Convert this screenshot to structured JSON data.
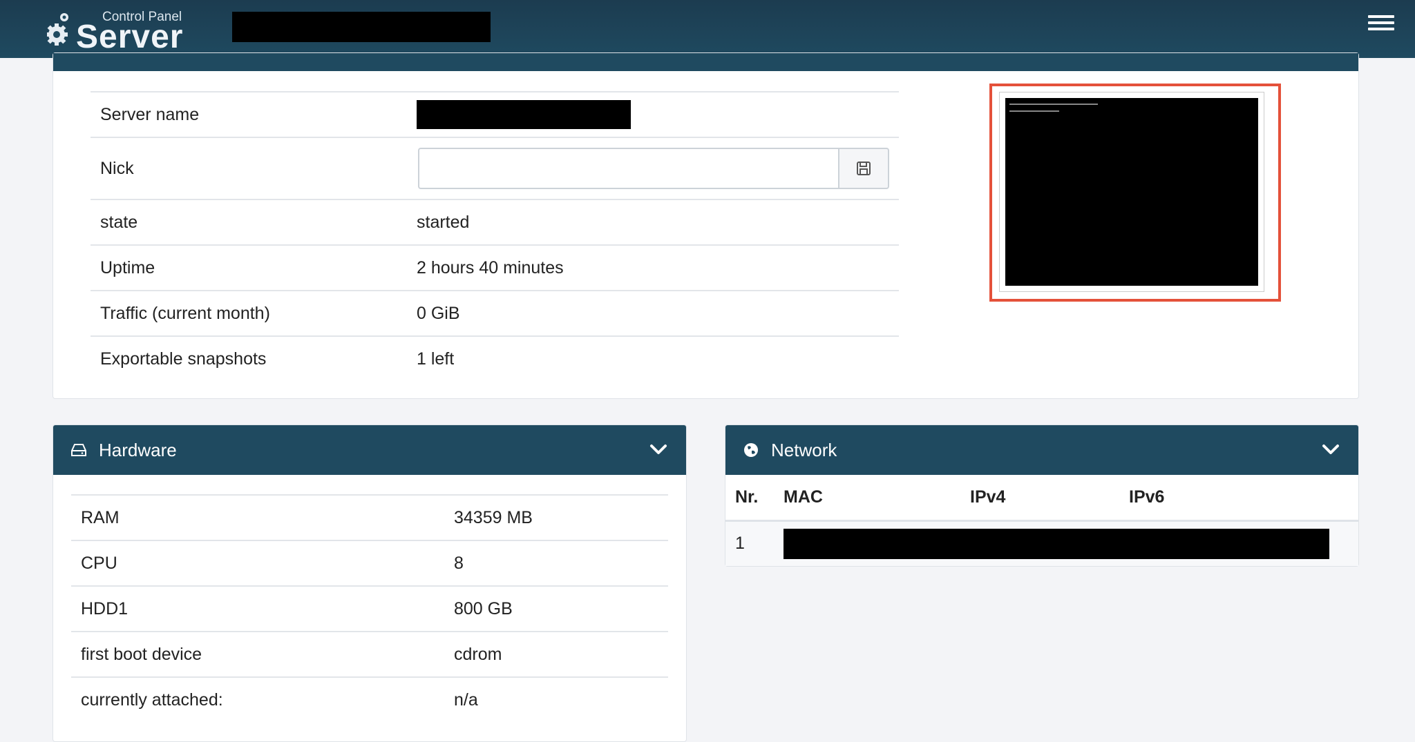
{
  "header": {
    "logo_small": "Control Panel",
    "logo_big": "Server",
    "menu_icon": "hamburger-icon"
  },
  "server_info": {
    "rows": [
      {
        "label": "Server name",
        "value": ""
      },
      {
        "label": "Nick",
        "value": ""
      },
      {
        "label": "state",
        "value": "started"
      },
      {
        "label": "Uptime",
        "value": "2 hours 40 minutes"
      },
      {
        "label": "Traffic (current month)",
        "value": "0 GiB"
      },
      {
        "label": "Exportable snapshots",
        "value": "1 left"
      }
    ],
    "nick_input_value": "",
    "nick_save_icon": "save-icon"
  },
  "hardware": {
    "title": "Hardware",
    "icon": "hdd-icon",
    "rows": [
      {
        "label": "RAM",
        "value": "34359 MB"
      },
      {
        "label": "CPU",
        "value": "8"
      },
      {
        "label": "HDD1",
        "value": "800 GB"
      },
      {
        "label": "first boot device",
        "value": "cdrom"
      },
      {
        "label": "currently attached:",
        "value": "n/a"
      }
    ]
  },
  "network": {
    "title": "Network",
    "icon": "globe-icon",
    "columns": [
      "Nr.",
      "MAC",
      "IPv4",
      "IPv6"
    ],
    "rows": [
      {
        "nr": "1"
      }
    ]
  },
  "colors": {
    "header_bg": "#1f4a60",
    "console_highlight": "#e4513a"
  }
}
